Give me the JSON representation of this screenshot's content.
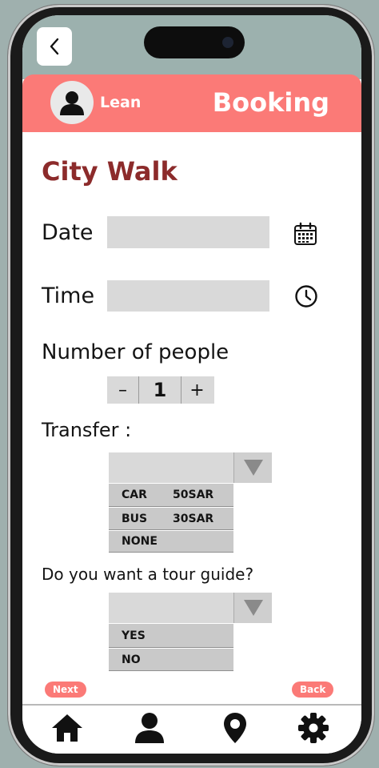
{
  "header": {
    "user_name": "Lean",
    "title": "Booking"
  },
  "page": {
    "title": "City Walk"
  },
  "form": {
    "date_label": "Date",
    "date_value": "",
    "time_label": "Time",
    "time_value": "",
    "people_label": "Number of people",
    "people_minus": "–",
    "people_count": "1",
    "people_plus": "+",
    "transfer_label": "Transfer :",
    "transfer_options": [
      {
        "name": "CAR",
        "price": "50SAR"
      },
      {
        "name": "BUS",
        "price": "30SAR"
      },
      {
        "name": "NONE",
        "price": ""
      }
    ],
    "guide_question": "Do you want a tour guide?",
    "guide_options": [
      "YES",
      "NO"
    ]
  },
  "actions": {
    "next_label": "Next",
    "back_label": "Back"
  },
  "icons": {
    "back": "chevron-left-icon",
    "calendar": "calendar-icon",
    "clock": "clock-icon",
    "home": "home-icon",
    "profile": "user-icon",
    "location": "map-pin-icon",
    "settings": "gear-icon"
  },
  "colors": {
    "accent": "#fb7a77",
    "title": "#8c2b2b",
    "field": "#d9d9d9"
  }
}
